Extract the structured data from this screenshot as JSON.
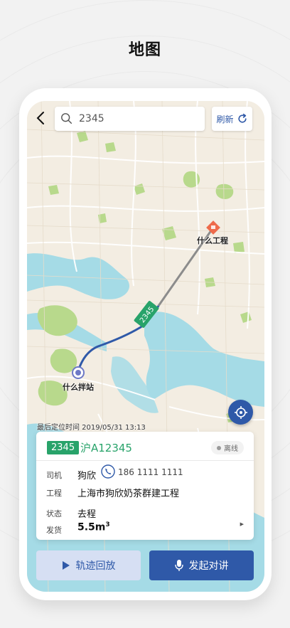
{
  "page_title": "地图",
  "search": {
    "value": "2345"
  },
  "refresh_label": "刷新",
  "map": {
    "dest_label": "什么工程",
    "origin_label": "什么拌站",
    "route_badge": "2345"
  },
  "last_location": "最后定位时间 2019/05/31 13:13",
  "card": {
    "truck_number": "2345",
    "plate": "沪A12345",
    "status_badge": "离线",
    "driver_label": "司机",
    "driver_name": "狗欣",
    "driver_phone": "186 1111 1111",
    "project_label": "工程",
    "project_name": "上海市狗欣奶茶群建工程",
    "state_label": "状态",
    "state_value": "去程",
    "shipment_label": "发货",
    "shipment_value": "5.5m",
    "shipment_unit_sup": "3"
  },
  "buttons": {
    "track_replay": "轨迹回放",
    "start_talk": "发起对讲"
  },
  "colors": {
    "primary": "#2f59a8",
    "accent_green": "#28a36a",
    "water": "#a5dbe6",
    "park": "#b8d98c",
    "land": "#f3ede2",
    "offline_gray": "#9a9a9a"
  }
}
